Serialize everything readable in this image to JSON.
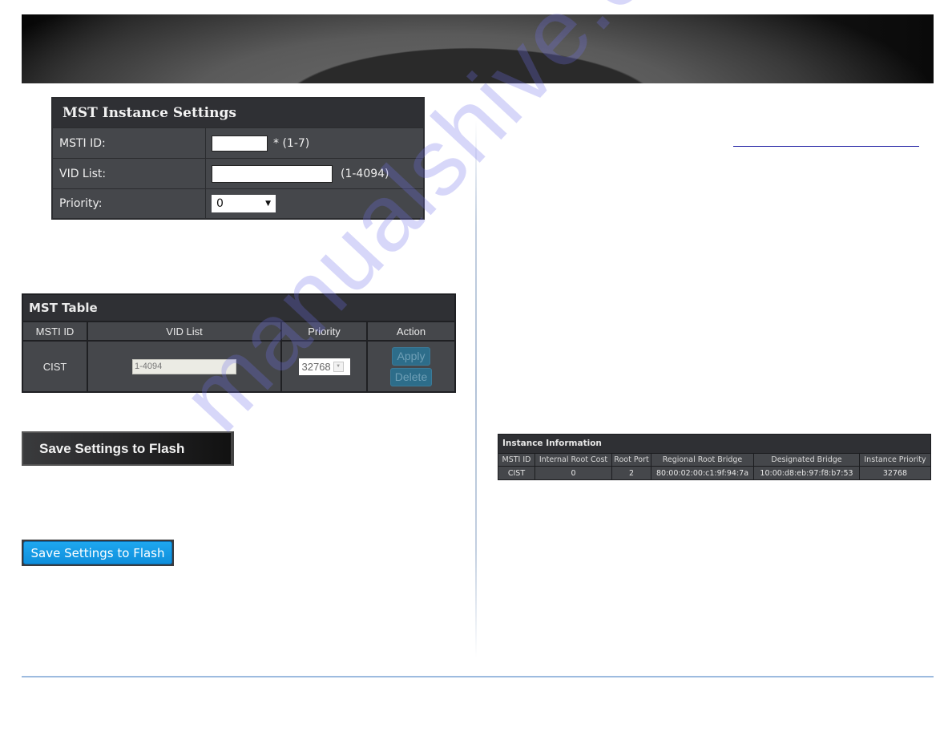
{
  "mst_instance_settings": {
    "title": "MST Instance Settings",
    "fields": [
      {
        "label": "MSTI ID:",
        "value": "",
        "hint": "* (1-7)"
      },
      {
        "label": "VID List:",
        "value": "",
        "hint": "(1-4094)"
      },
      {
        "label": "Priority:",
        "selected": "0"
      }
    ]
  },
  "mst_table": {
    "title": "MST Table",
    "columns": [
      "MSTI ID",
      "VID List",
      "Priority",
      "Action"
    ],
    "rows": [
      {
        "msti_id": "CIST",
        "vid_list": "1-4094",
        "priority": "32768",
        "actions": {
          "apply": "Apply",
          "delete": "Delete"
        }
      }
    ]
  },
  "save_buttons": {
    "dark_label": "Save Settings to Flash",
    "blue_label": "Save Settings to Flash"
  },
  "instance_information": {
    "title": "Instance Information",
    "columns": [
      "MSTI ID",
      "Internal Root Cost",
      "Root Port",
      "Regional Root Bridge",
      "Designated Bridge",
      "Instance Priority"
    ],
    "rows": [
      [
        "CIST",
        "0",
        "2",
        "80:00:02:00:c1:9f:94:7a",
        "10:00:d8:eb:97:f8:b7:53",
        "32768"
      ]
    ]
  },
  "watermark": "manualshive.com",
  "colors": {
    "panel_bg": "#45474b",
    "panel_header_bg": "#2f3034",
    "button_blue": "#1399e6",
    "disabled_button": "#2d6d8a",
    "rule_blue": "#9dbbdf",
    "link_blue": "#1a1aa0"
  }
}
